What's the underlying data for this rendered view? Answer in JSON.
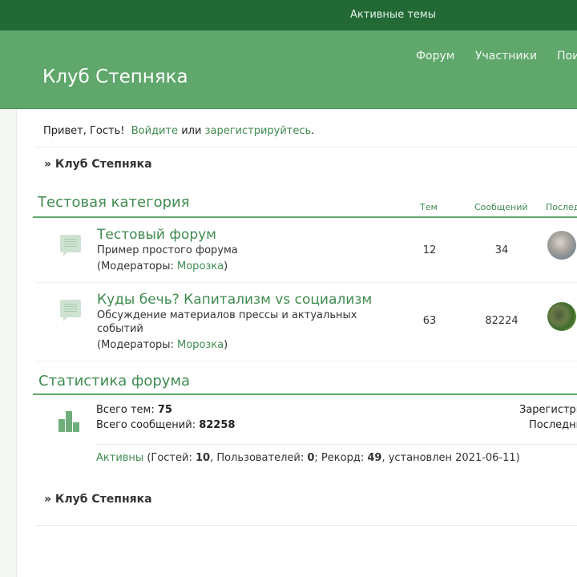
{
  "topbar": {
    "active_topics": "Активные темы"
  },
  "header": {
    "site_title": "Клуб Степняка",
    "nav": [
      "Форум",
      "Участники",
      "Поиск"
    ]
  },
  "greeting": {
    "hello": "Привет, Гость!",
    "login": "Войдите",
    "or": "или",
    "register": "зарегистрируйтесь",
    "dot": "."
  },
  "breadcrumb": {
    "top": "» Клуб Степняка",
    "bottom": "» Клуб Степняка"
  },
  "category": {
    "title": "Тестовая категория",
    "columns": {
      "topics": "Тем",
      "posts": "Сообщений",
      "last": "Последнее сообщение"
    },
    "forums": [
      {
        "name": "Тестовый форум",
        "description": "Пример простого форума",
        "moderators_label": "(Модераторы: ",
        "moderator": "Морозка",
        "moderators_close": ")",
        "topics": "12",
        "posts": "34"
      },
      {
        "name": "Куды бечь? Капитализм vs социализм",
        "description": "Обсуждение материалов прессы и актуальных событий",
        "moderators_label": "(Модераторы: ",
        "moderator": "Морозка",
        "moderators_close": ")",
        "topics": "63",
        "posts": "82224"
      }
    ]
  },
  "stats": {
    "title": "Статистика форума",
    "total_topics_label": "Всего тем: ",
    "total_topics": "75",
    "total_posts_label": "Всего сообщений: ",
    "total_posts": "82258",
    "right_1": "Зарегистрировано участников",
    "right_2": "Последний",
    "online": {
      "active": "Активны",
      "guests_label": " (Гостей: ",
      "guests": "10",
      "users_label": ", Пользователей: ",
      "users": "0",
      "record_label": "; Рекорд: ",
      "record": "49",
      "record_date": ", установлен 2021-06-11)"
    }
  }
}
